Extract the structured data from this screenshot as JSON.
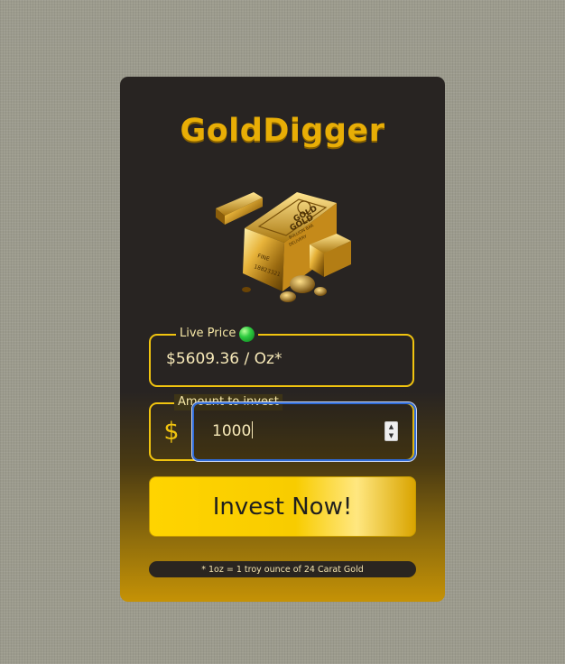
{
  "app": {
    "brand": "GoldDigger",
    "accent_color": "#f1c40f",
    "brand_color": "#e8ae06"
  },
  "hero": {
    "icon": "gold-bars-image",
    "bar_text_lines": [
      "GOLD",
      "GOLD",
      "BULLION BAR",
      "DELIVERY",
      "FINE",
      "18823321"
    ]
  },
  "price": {
    "legend": "Live Price",
    "status_icon": "green-dot-icon",
    "status_color": "#2ecc40",
    "value": "$5609.36 / Oz*"
  },
  "amount": {
    "legend": "Amount to invest",
    "currency_symbol": "$",
    "value": "1000",
    "spinner_up": "▲",
    "spinner_down": "▼"
  },
  "cta": {
    "label": "Invest Now!"
  },
  "footnote": {
    "text": "* 1oz = 1 troy ounce of 24 Carat Gold"
  }
}
